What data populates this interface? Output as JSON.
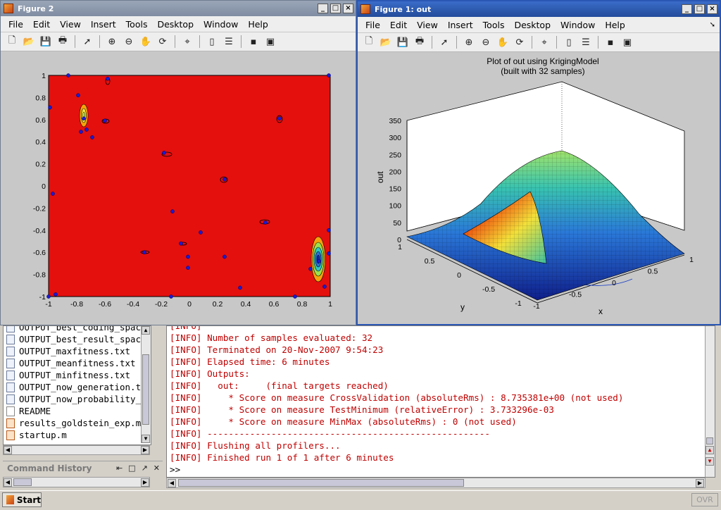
{
  "figure2": {
    "title": "Figure 2",
    "menu": [
      "File",
      "Edit",
      "View",
      "Insert",
      "Tools",
      "Desktop",
      "Window",
      "Help"
    ],
    "plot": {
      "xticks": [
        "-1",
        "-0.8",
        "-0.6",
        "-0.4",
        "-0.2",
        "0",
        "0.2",
        "0.4",
        "0.6",
        "0.8",
        "1"
      ],
      "yticks": [
        "1",
        "0.8",
        "0.6",
        "0.4",
        "0.2",
        "0",
        "-0.2",
        "-0.4",
        "-0.6",
        "-0.8",
        "-1"
      ]
    }
  },
  "figure1": {
    "title": "Figure 1: out",
    "menu": [
      "File",
      "Edit",
      "View",
      "Insert",
      "Tools",
      "Desktop",
      "Window",
      "Help"
    ],
    "plot": {
      "title_line1": "Plot of out using KrigingModel",
      "title_line2": "(built with 32 samples)",
      "zlabel": "out",
      "ylabel": "y",
      "xlabel": "x",
      "zticks": [
        "350",
        "300",
        "250",
        "200",
        "150",
        "100",
        "50",
        "0"
      ],
      "yticks": [
        "1",
        "0.5",
        "0",
        "-0.5",
        "-1"
      ],
      "xticks": [
        "-1",
        "-0.5",
        "0",
        "0.5",
        "1"
      ]
    }
  },
  "chart_data": [
    {
      "type": "heatmap",
      "title": "",
      "xlabel": "",
      "ylabel": "",
      "xlim": [
        -1,
        1
      ],
      "ylim": [
        -1,
        1
      ],
      "sample_points": [
        {
          "x": -0.86,
          "y": 1.0
        },
        {
          "x": -0.58,
          "y": 0.97
        },
        {
          "x": 0.99,
          "y": 1.0
        },
        {
          "x": -0.79,
          "y": 0.82
        },
        {
          "x": -0.99,
          "y": 0.71
        },
        {
          "x": -0.75,
          "y": 0.61
        },
        {
          "x": -0.77,
          "y": 0.49
        },
        {
          "x": -0.73,
          "y": 0.51
        },
        {
          "x": -0.69,
          "y": 0.44
        },
        {
          "x": -0.6,
          "y": 0.59
        },
        {
          "x": 0.64,
          "y": 0.61
        },
        {
          "x": -0.18,
          "y": 0.3
        },
        {
          "x": 0.25,
          "y": 0.06
        },
        {
          "x": -0.97,
          "y": -0.07
        },
        {
          "x": -0.12,
          "y": -0.23
        },
        {
          "x": 0.54,
          "y": -0.33
        },
        {
          "x": 0.08,
          "y": -0.42
        },
        {
          "x": -0.06,
          "y": -0.52
        },
        {
          "x": -0.32,
          "y": -0.6
        },
        {
          "x": -0.01,
          "y": -0.64
        },
        {
          "x": 0.25,
          "y": -0.64
        },
        {
          "x": -0.01,
          "y": -0.74
        },
        {
          "x": 0.86,
          "y": -0.75
        },
        {
          "x": 0.99,
          "y": -0.61
        },
        {
          "x": 0.99,
          "y": -0.4
        },
        {
          "x": 0.36,
          "y": -0.92
        },
        {
          "x": -0.13,
          "y": -1.0
        },
        {
          "x": 0.75,
          "y": -1.0
        },
        {
          "x": 0.96,
          "y": -0.91
        },
        {
          "x": -1.0,
          "y": -1.0
        },
        {
          "x": -0.95,
          "y": -0.98
        },
        {
          "x": 0.92,
          "y": -0.68
        }
      ]
    },
    {
      "type": "surface",
      "title": "Plot of out using KrigingModel (built with 32 samples)",
      "xlabel": "x",
      "ylabel": "y",
      "zlabel": "out",
      "xlim": [
        -1,
        1
      ],
      "ylim": [
        -1,
        1
      ],
      "zlim": [
        0,
        350
      ]
    }
  ],
  "filelist": {
    "items": [
      {
        "name": "OUTPUT_best_coding_spac",
        "kind": "txt"
      },
      {
        "name": "OUTPUT_best_result_spac",
        "kind": "txt"
      },
      {
        "name": "OUTPUT_maxfitness.txt",
        "kind": "txt"
      },
      {
        "name": "OUTPUT_meanfitness.txt",
        "kind": "txt"
      },
      {
        "name": "OUTPUT_minfitness.txt",
        "kind": "txt"
      },
      {
        "name": "OUTPUT_now_generation.t",
        "kind": "txt"
      },
      {
        "name": "OUTPUT_now_probability_",
        "kind": "txt"
      },
      {
        "name": "README",
        "kind": "doc"
      },
      {
        "name": "results_goldstein_exp.m",
        "kind": "m"
      },
      {
        "name": "startup.m",
        "kind": "m"
      }
    ]
  },
  "command_history": {
    "title": "Command History"
  },
  "console": {
    "lines": [
      "[INFO]",
      "[INFO] Number of samples evaluated: 32",
      "[INFO] Terminated on 20-Nov-2007 9:54:23",
      "[INFO] Elapsed time: 6 minutes",
      "[INFO] Outputs:",
      "[INFO]   out:     (final targets reached)",
      "[INFO]     * Score on measure CrossValidation (absoluteRms) : 8.735381e+00 (not used)",
      "[INFO]     * Score on measure TestMinimum (relativeError) : 3.733296e-03",
      "[INFO]     * Score on measure MinMax (absoluteRms) : 0 (not used)",
      "[INFO] -----------------------------------------------------",
      "[INFO] Flushing all profilers...",
      "[INFO] Finished run 1 of 1 after 6 minutes"
    ],
    "prompt": ">>"
  },
  "taskbar": {
    "start_label": "Start",
    "ovr_label": "OVR"
  }
}
